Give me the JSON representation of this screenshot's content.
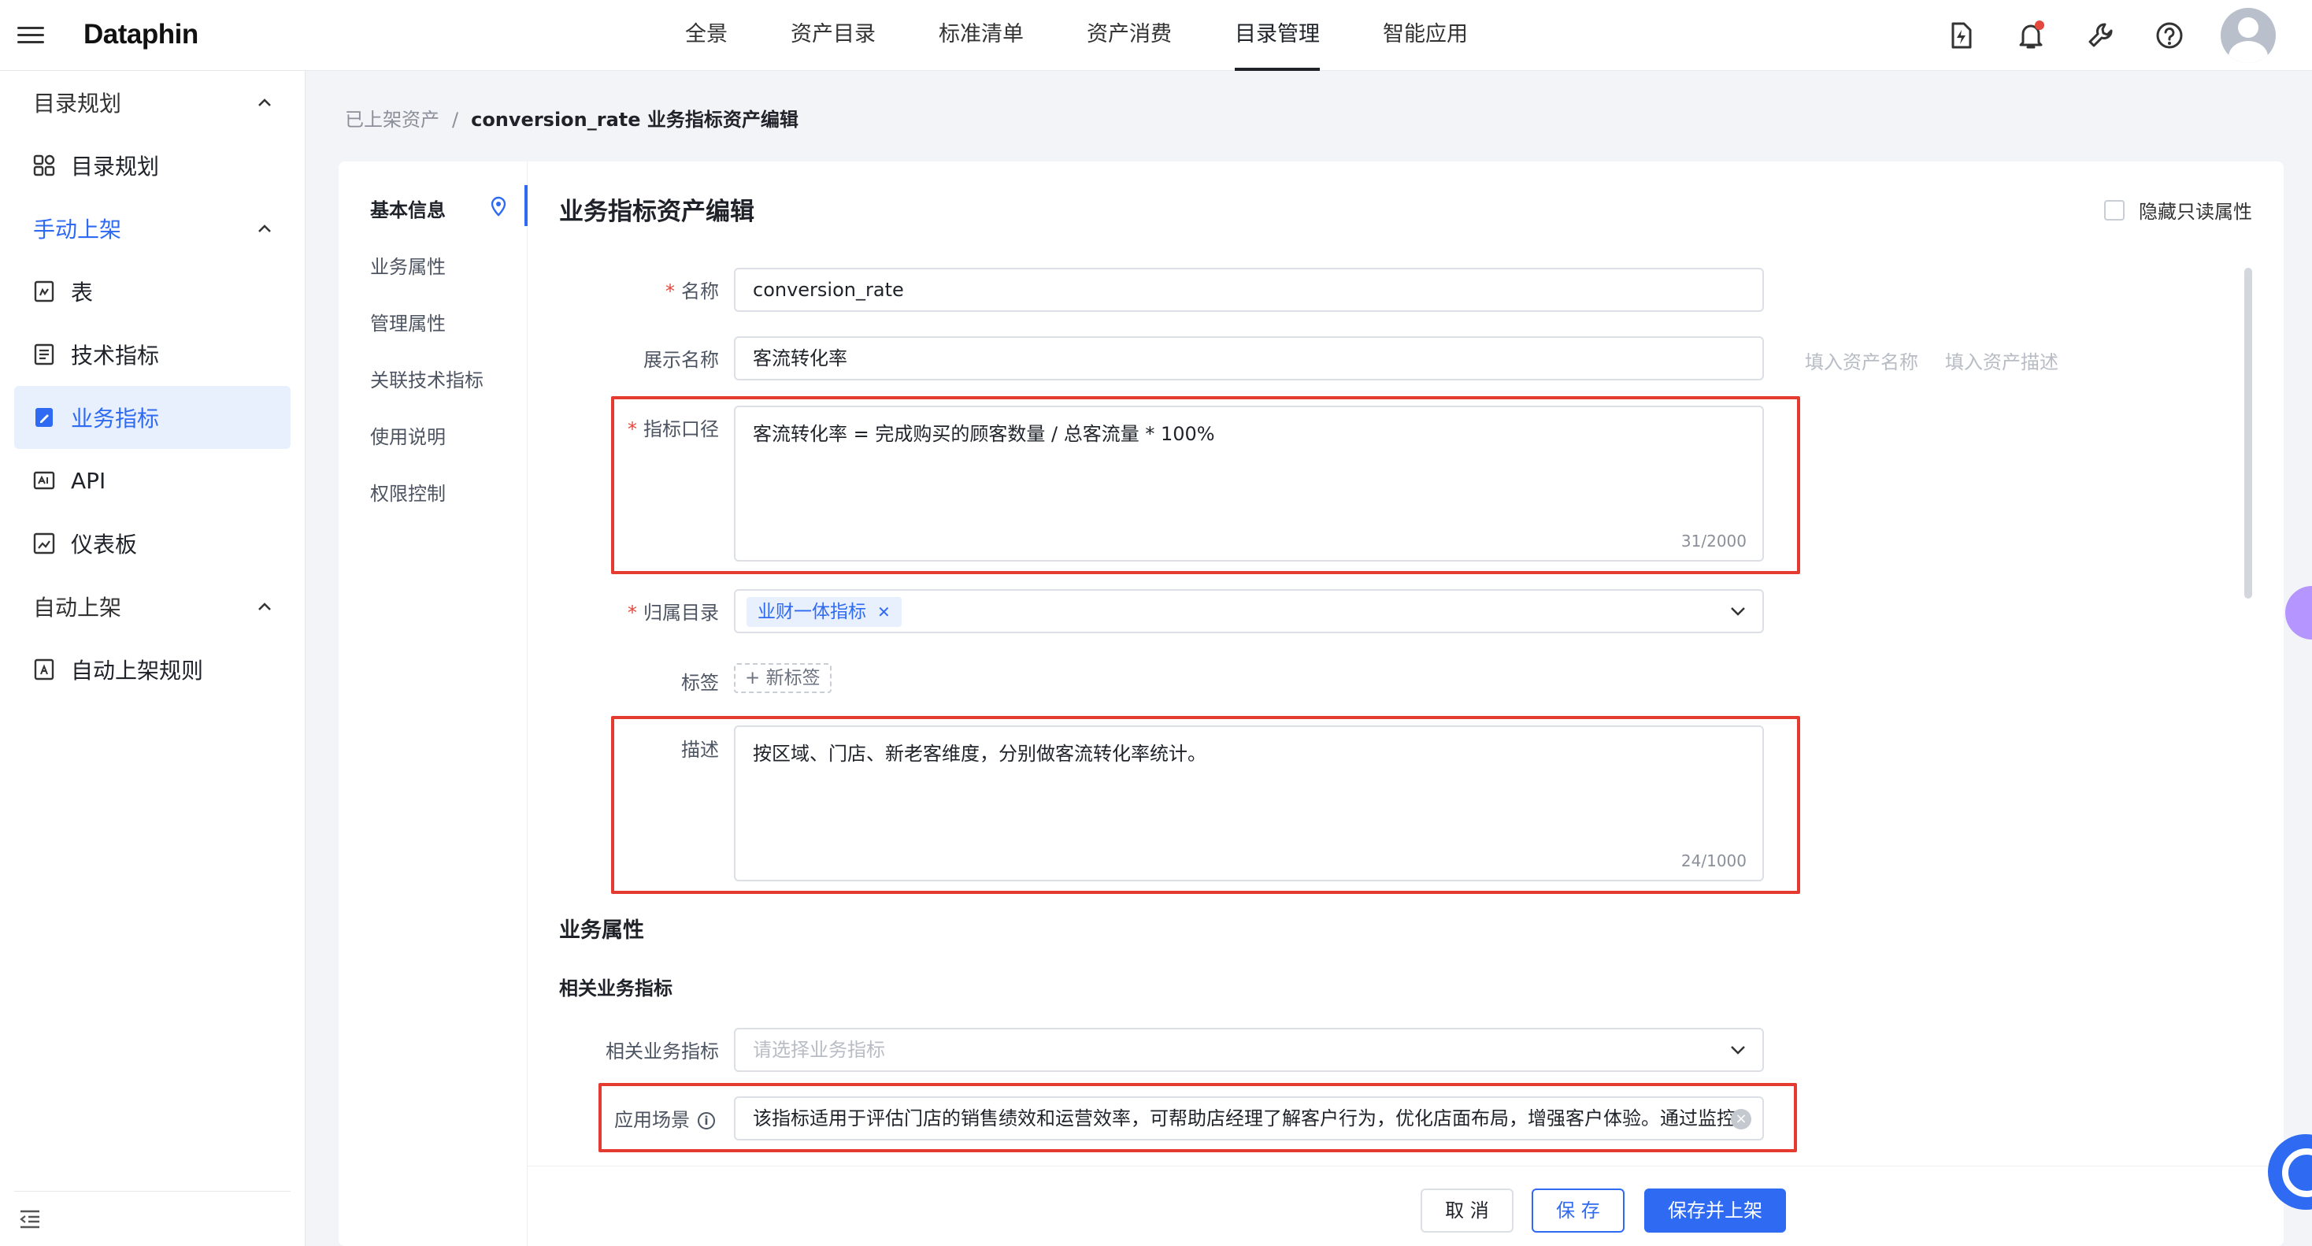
{
  "app": {
    "logo": "Dataphin",
    "top_nav": [
      {
        "label": "全景",
        "active": false
      },
      {
        "label": "资产目录",
        "active": false
      },
      {
        "label": "标准清单",
        "active": false
      },
      {
        "label": "资产消费",
        "active": false
      },
      {
        "label": "目录管理",
        "active": true
      },
      {
        "label": "智能应用",
        "active": false
      }
    ]
  },
  "sidebar": {
    "group1": "目录规划",
    "item_catalog": "目录规划",
    "group2": "手动上架",
    "item_table": "表",
    "item_tech": "技术指标",
    "item_biz": "业务指标",
    "item_api": "API",
    "item_dashboard": "仪表板",
    "group3": "自动上架",
    "item_auto_rule": "自动上架规则"
  },
  "breadcrumb": {
    "parent": "已上架资产",
    "separator": "/",
    "current": "conversion_rate 业务指标资产编辑"
  },
  "anchor_nav": {
    "basic": "基本信息",
    "biz_attr": "业务属性",
    "mgmt_attr": "管理属性",
    "related_tech": "关联技术指标",
    "usage": "使用说明",
    "permission": "权限控制"
  },
  "form": {
    "title": "业务指标资产编辑",
    "hide_readonly": "隐藏只读属性",
    "required_mark": "*",
    "name_label": "名称",
    "name_value": "conversion_rate",
    "display_label": "展示名称",
    "display_value": "客流转化率",
    "hint_name": "填入资产名称",
    "hint_desc": "填入资产描述",
    "caliber_label": "指标口径",
    "caliber_value": "客流转化率 = 完成购买的顾客数量 / 总客流量 * 100%",
    "caliber_count": "31/2000",
    "catalog_label": "归属目录",
    "catalog_tag": "业财一体指标",
    "tags_label": "标签",
    "new_tag": "+ 新标签",
    "desc_label": "描述",
    "desc_value": "按区域、门店、新老客维度，分别做客流转化率统计。",
    "desc_count": "24/1000",
    "section_biz": "业务属性",
    "sub_related": "相关业务指标",
    "related_label": "相关业务指标",
    "related_placeholder": "请选择业务指标",
    "scene_label": "应用场景",
    "scene_value": "该指标适用于评估门店的销售绩效和运营效率，可帮助店经理了解客户行为，优化店面布局，增强客户体验。通过监控"
  },
  "footer": {
    "cancel": "取 消",
    "save": "保 存",
    "save_publish": "保存并上架"
  },
  "colors": {
    "accent": "#2f6bf2",
    "highlight_frame": "#e53a2f"
  }
}
